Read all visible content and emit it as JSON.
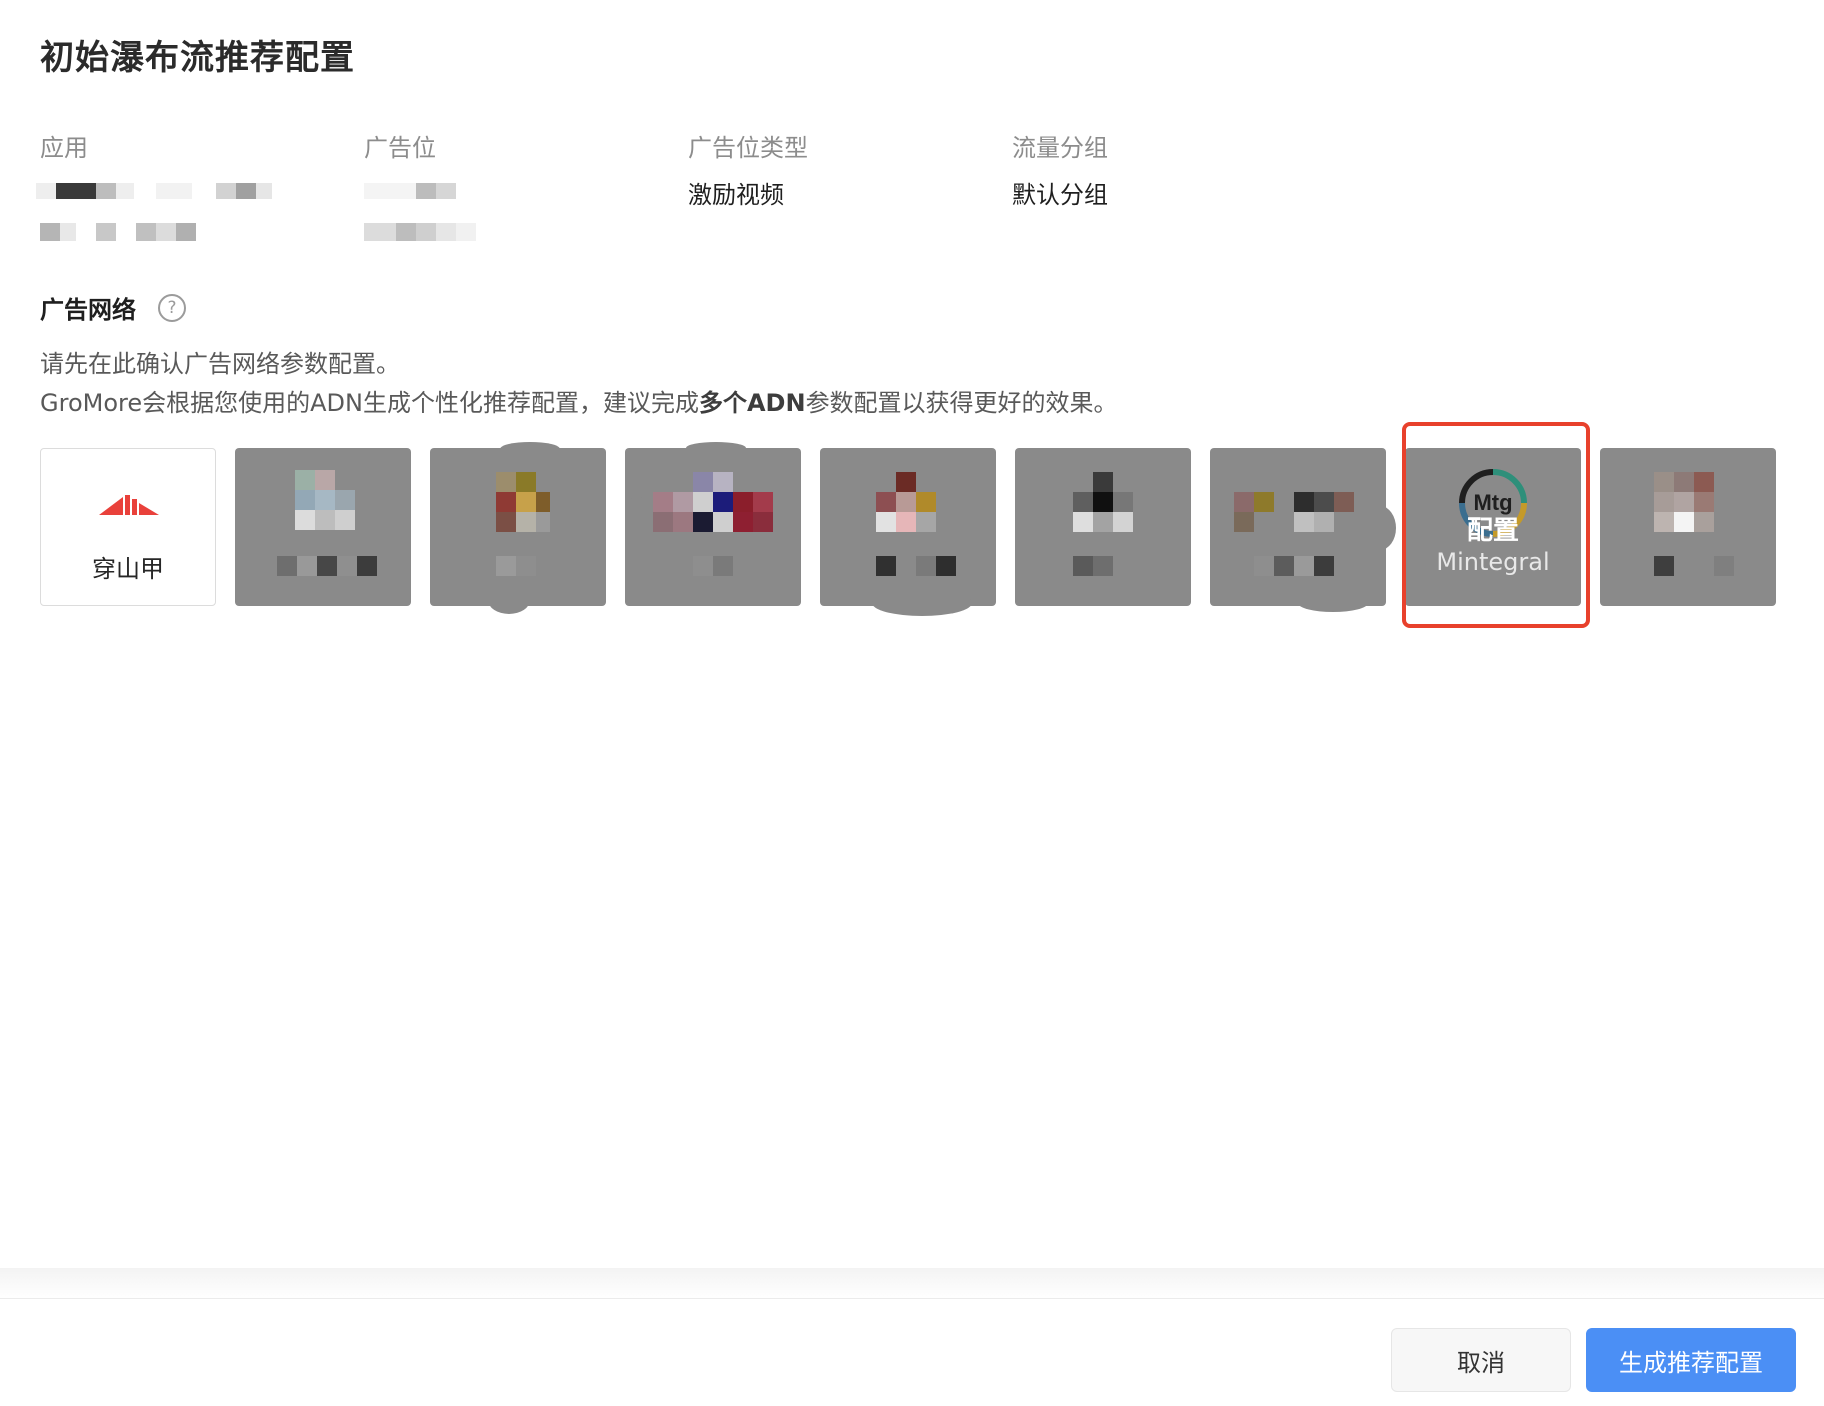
{
  "dialog": {
    "title": "初始瀑布流推荐配置"
  },
  "info": {
    "app_label": "应用",
    "adslot_label": "广告位",
    "adslot_type_label": "广告位类型",
    "adslot_type_value": "激励视频",
    "traffic_group_label": "流量分组",
    "traffic_group_value": "默认分组"
  },
  "ad_network": {
    "title": "广告网络",
    "help_glyph": "?",
    "desc_line1": "请先在此确认广告网络参数配置。",
    "desc_line2_a": "GroMore会根据您使用的ADN生成个性化推荐配置，建议完成",
    "desc_line2_b": "多个ADN",
    "desc_line2_c": "参数配置以获得更好的效果。",
    "cards": [
      {
        "name": "穿山甲",
        "state": "normal"
      },
      {
        "name": "",
        "state": "masked"
      },
      {
        "name": "",
        "state": "masked"
      },
      {
        "name": "",
        "state": "masked"
      },
      {
        "name": "",
        "state": "masked"
      },
      {
        "name": "",
        "state": "masked"
      },
      {
        "name": "",
        "state": "masked"
      },
      {
        "name": "Mintegral",
        "state": "masked",
        "overlay": "配置",
        "logo_text": "Mtg",
        "highlighted": true
      },
      {
        "name": "",
        "state": "masked"
      }
    ]
  },
  "footer": {
    "cancel_label": "取消",
    "submit_label": "生成推荐配置"
  },
  "colors": {
    "primary": "#4b8ff5",
    "highlight": "#e8412c",
    "mask": "#8a8a8a",
    "logo_red": "#e9413b"
  }
}
